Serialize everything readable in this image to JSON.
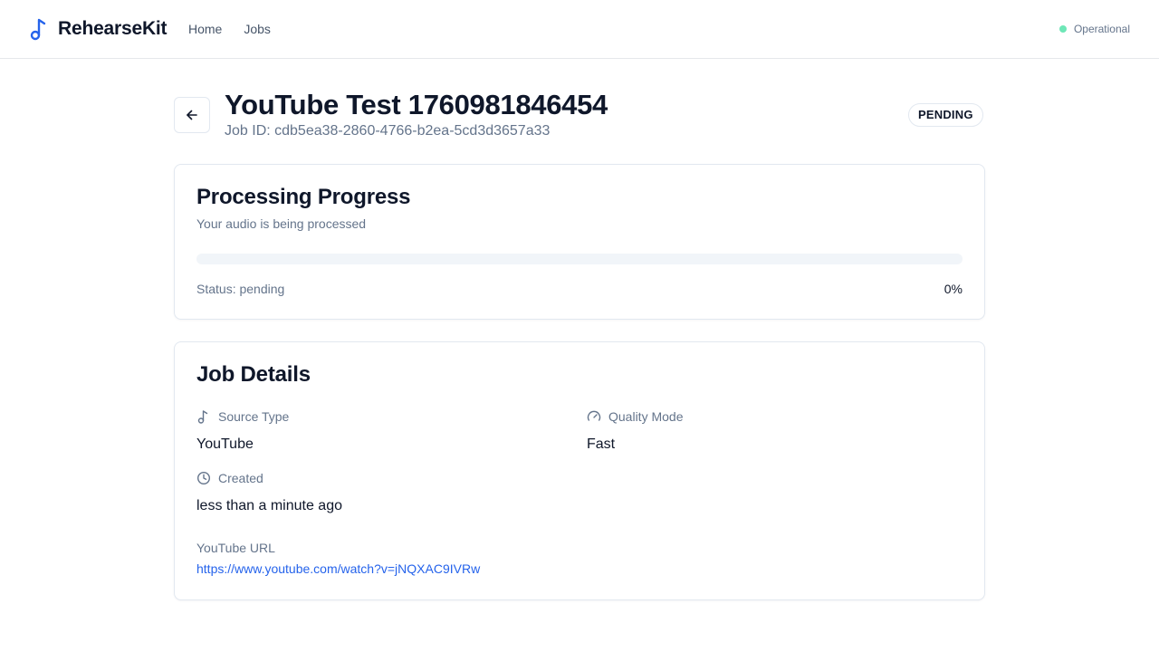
{
  "app": {
    "name": "RehearseKit",
    "nav": [
      {
        "label": "Home"
      },
      {
        "label": "Jobs"
      }
    ],
    "system_status": "Operational",
    "colors": {
      "brand": "#2563eb",
      "status_ok": "#6ee7b7",
      "link": "#2563eb"
    }
  },
  "job": {
    "title": "YouTube Test 1760981846454",
    "id_text": "Job ID: cdb5ea38-2860-4766-b2ea-5cd3d3657a33",
    "status_badge": "PENDING"
  },
  "progress_card": {
    "title": "Processing Progress",
    "subtitle": "Your audio is being processed",
    "progress_fraction": 0,
    "status_text": "Status: pending",
    "percent_text": "0%"
  },
  "details_card": {
    "title": "Job Details",
    "source_type": {
      "label": "Source Type",
      "value": "YouTube",
      "icon": "music-note-icon"
    },
    "quality_mode": {
      "label": "Quality Mode",
      "value": "Fast",
      "icon": "gauge-icon"
    },
    "created": {
      "label": "Created",
      "value": "less than a minute ago",
      "icon": "clock-icon"
    },
    "youtube_url": {
      "label": "YouTube URL",
      "value": "https://www.youtube.com/watch?v=jNQXAC9IVRw"
    }
  }
}
